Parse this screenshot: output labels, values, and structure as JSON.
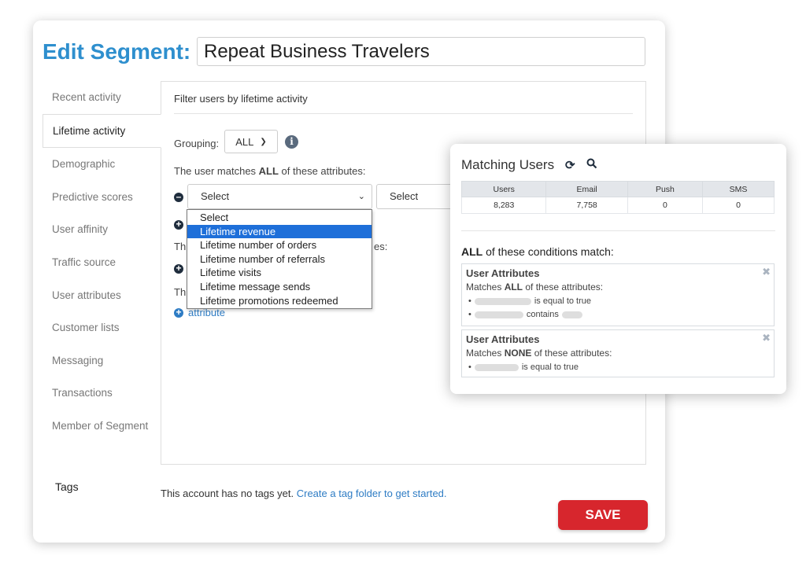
{
  "header": {
    "title": "Edit Segment:",
    "segment_name": "Repeat Business Travelers"
  },
  "sidebar": {
    "items": [
      {
        "label": "Recent activity"
      },
      {
        "label": "Lifetime activity",
        "active": true
      },
      {
        "label": "Demographic"
      },
      {
        "label": "Predictive scores"
      },
      {
        "label": "User affinity"
      },
      {
        "label": "Traffic source"
      },
      {
        "label": "User attributes"
      },
      {
        "label": "Customer lists"
      },
      {
        "label": "Messaging"
      },
      {
        "label": "Transactions"
      },
      {
        "label": "Member of Segment"
      }
    ]
  },
  "panel": {
    "heading": "Filter users by lifetime activity",
    "grouping_label": "Grouping:",
    "grouping_value": "ALL",
    "match_prefix": "The user matches ",
    "match_bold": "ALL",
    "match_suffix": " of these attributes:",
    "select1_value": "Select",
    "select2_value": "Select",
    "partial_text_a": "Th",
    "partial_text_a_tail": "es:",
    "partial_text_b": "Th",
    "attribute_link": "attribute"
  },
  "dropdown": {
    "options": [
      {
        "label": "Select"
      },
      {
        "label": "Lifetime revenue",
        "highlighted": true
      },
      {
        "label": "Lifetime number of orders"
      },
      {
        "label": "Lifetime number of referrals"
      },
      {
        "label": "Lifetime visits"
      },
      {
        "label": "Lifetime message sends"
      },
      {
        "label": "Lifetime promotions redeemed"
      }
    ]
  },
  "tags": {
    "label": "Tags",
    "message": "This account has no tags yet.",
    "link": "Create a tag folder to get started."
  },
  "save_label": "SAVE",
  "matching": {
    "title": "Matching Users",
    "columns": [
      "Users",
      "Email",
      "Push",
      "SMS"
    ],
    "values": [
      "8,283",
      "7,758",
      "0",
      "0"
    ],
    "conditions_bold": "ALL",
    "conditions_suffix": " of these conditions match:",
    "boxes": [
      {
        "title": "User Attributes",
        "sub_prefix": "Matches ",
        "sub_bold": "ALL",
        "sub_suffix": " of these attributes:",
        "row1_text": "is equal to true",
        "row2_text": "contains"
      },
      {
        "title": "User Attributes",
        "sub_prefix": "Matches ",
        "sub_bold": "NONE",
        "sub_suffix": " of these attributes:",
        "row1_text": "is equal to true"
      }
    ]
  },
  "colors": {
    "accent": "#2e8fce",
    "save": "#d7262d",
    "highlight": "#1e6fd9"
  },
  "icons": [
    "info-icon",
    "minus-circle-icon",
    "plus-circle-icon",
    "refresh-icon",
    "search-icon",
    "close-icon",
    "chevron-down-icon"
  ]
}
